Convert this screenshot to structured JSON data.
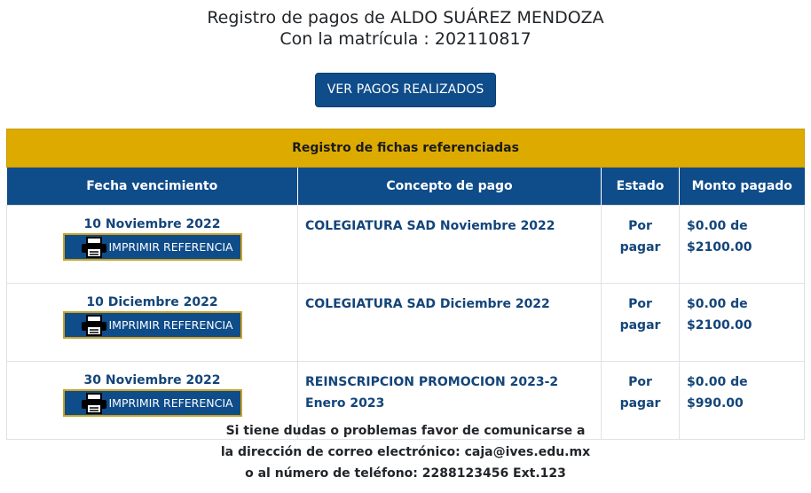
{
  "header": {
    "title": "Registro de pagos de ALDO SUÁREZ MENDOZA",
    "subtitle": "Con la matrícula : 202110817",
    "view_payments_label": "VER PAGOS REALIZADOS"
  },
  "table": {
    "caption": "Registro de fichas referenciadas",
    "columns": [
      "Fecha vencimiento",
      "Concepto de pago",
      "Estado",
      "Monto pagado"
    ],
    "print_label": "IMPRIMIR REFERENCIA",
    "rows": [
      {
        "fecha": "10 Noviembre 2022",
        "concepto_1": "COLEGIATURA SAD Noviembre 2022",
        "concepto_2": "",
        "estado_1": "Por",
        "estado_2": "pagar",
        "monto_1": "$0.00 de",
        "monto_2": "$2100.00"
      },
      {
        "fecha": "10 Diciembre 2022",
        "concepto_1": "COLEGIATURA SAD Diciembre 2022",
        "concepto_2": "",
        "estado_1": "Por",
        "estado_2": "pagar",
        "monto_1": "$0.00 de",
        "monto_2": "$2100.00"
      },
      {
        "fecha": "30 Noviembre 2022",
        "concepto_1": "REINSCRIPCION PROMOCION 2023-2",
        "concepto_2": "Enero 2023",
        "estado_1": "Por",
        "estado_2": "pagar",
        "monto_1": "$0.00 de",
        "monto_2": "$990.00"
      }
    ]
  },
  "footer": {
    "line1": "Si tiene dudas o problemas favor de comunicarse a",
    "line2": "la dirección de correo electrónico: caja@ives.edu.mx",
    "line3": "o al número de teléfono: 2288123456 Ext.123"
  },
  "colors": {
    "primary": "#0f4c8a",
    "gold": "#ddab00",
    "text_blue": "#14457a"
  },
  "icons": {
    "print": "printer-icon"
  }
}
